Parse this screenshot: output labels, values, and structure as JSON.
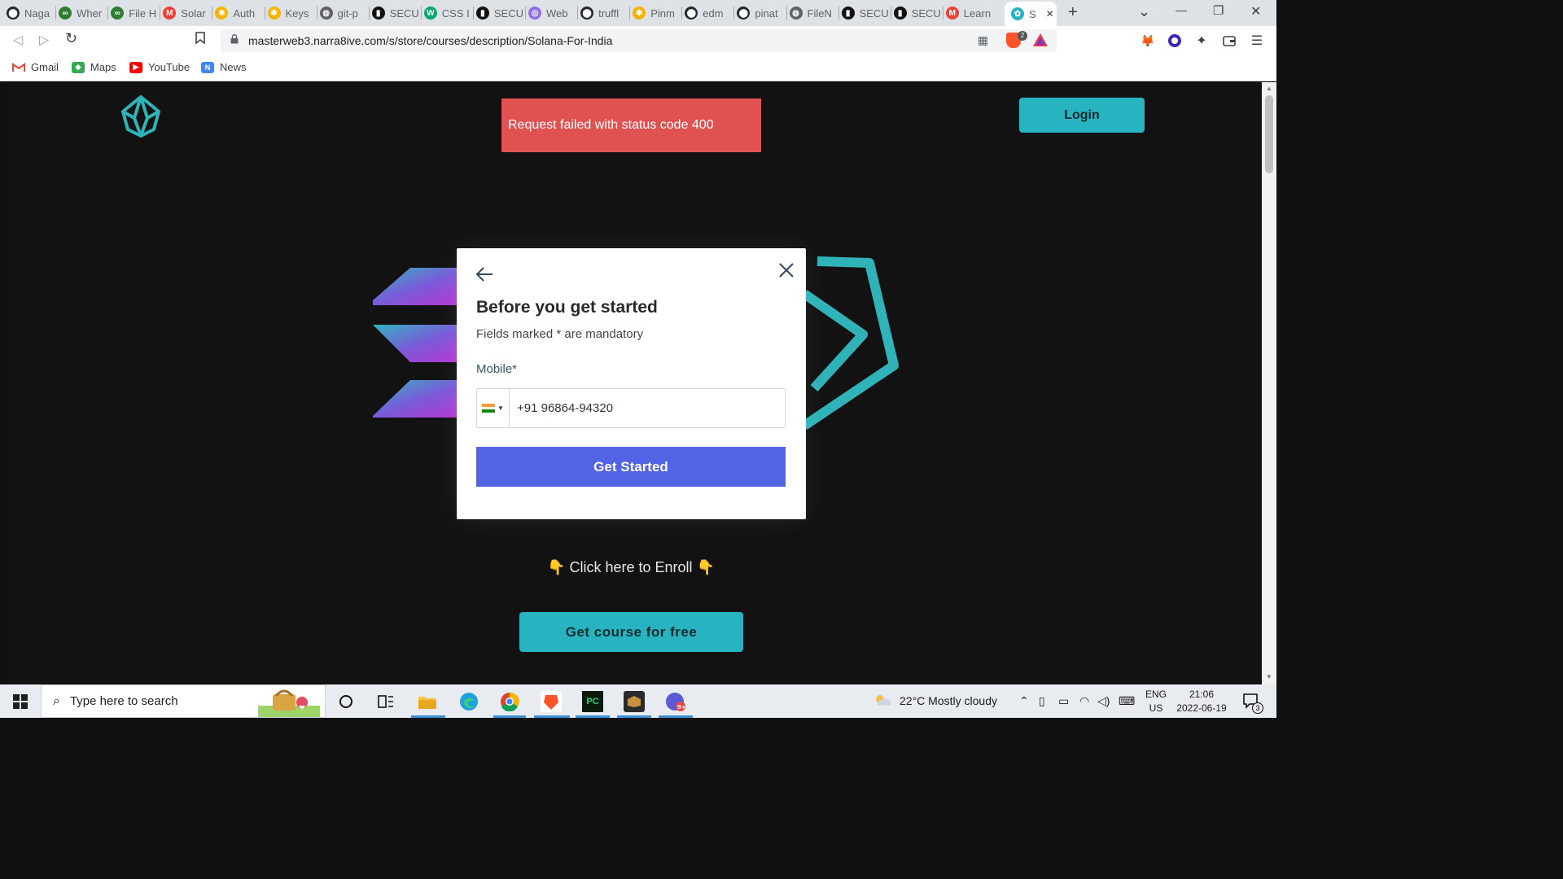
{
  "browser": {
    "tabs": [
      {
        "label": "Naga",
        "icon": "github-icon"
      },
      {
        "label": "Wher",
        "icon": "infinity-icon"
      },
      {
        "label": "File H",
        "icon": "infinity-icon"
      },
      {
        "label": "Solar",
        "icon": "gmail-icon"
      },
      {
        "label": "Auth",
        "icon": "pinwheel-icon"
      },
      {
        "label": "Keys",
        "icon": "pinwheel-icon"
      },
      {
        "label": "git-p",
        "icon": "globe-icon"
      },
      {
        "label": "SECU",
        "icon": "notion-icon"
      },
      {
        "label": "CSS I",
        "icon": "w3-icon"
      },
      {
        "label": "SECU",
        "icon": "notion-icon"
      },
      {
        "label": "Web",
        "icon": "web3-icon"
      },
      {
        "label": "truffl",
        "icon": "github-icon"
      },
      {
        "label": "Pinm",
        "icon": "pinwheel-icon"
      },
      {
        "label": "edm",
        "icon": "github-icon"
      },
      {
        "label": "pinat",
        "icon": "github-icon"
      },
      {
        "label": "FileN",
        "icon": "globe-icon"
      },
      {
        "label": "SECU",
        "icon": "notion-icon"
      },
      {
        "label": "SECU",
        "icon": "notion-icon"
      },
      {
        "label": "Learn",
        "icon": "gmail-icon"
      }
    ],
    "active_tab": {
      "label": "S",
      "icon": "lotus-icon"
    },
    "url": "masterweb3.narra8ive.com/s/store/courses/description/Solana-For-India",
    "brave_badge": "2",
    "bookmarks": [
      {
        "label": "Gmail",
        "color": "#ea4335"
      },
      {
        "label": "Maps",
        "color": "#34a853"
      },
      {
        "label": "YouTube",
        "color": "#ff0000"
      },
      {
        "label": "News",
        "color": "#4285f4"
      }
    ]
  },
  "page": {
    "toast": "Request failed with status code 400",
    "login_label": "Login",
    "enroll_text": "👇 Click here to Enroll 👇",
    "free_button": "Get course for free",
    "accent_color": "#27b3bf"
  },
  "modal": {
    "title": "Before you get started",
    "subtitle": "Fields marked * are mandatory",
    "mobile_label": "Mobile*",
    "phone_value": "+91 96864-94320",
    "cta_label": "Get Started",
    "cta_color": "#5263e4"
  },
  "taskbar": {
    "search_placeholder": "Type here to search",
    "weather": "22°C  Mostly cloudy",
    "lang_top": "ENG",
    "lang_bottom": "US",
    "time": "21:06",
    "date": "2022-06-19",
    "notification_count": "3"
  }
}
